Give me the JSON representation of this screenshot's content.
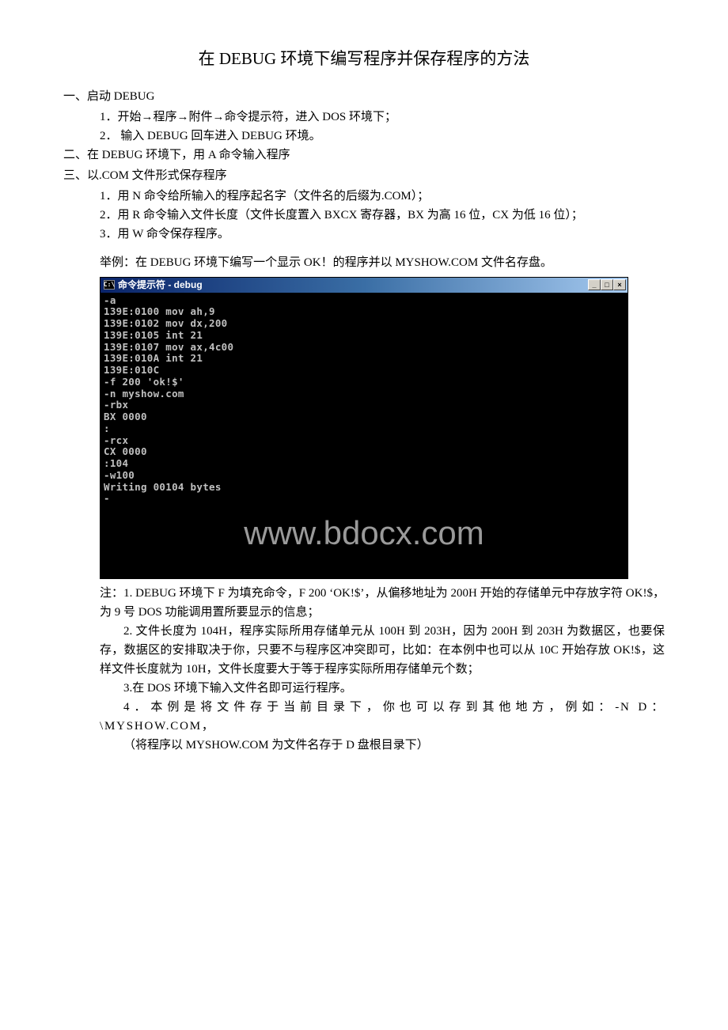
{
  "title": "在 DEBUG 环境下编写程序并保存程序的方法",
  "section1": {
    "heading": "一、启动 DEBUG",
    "item1": "1．开始→程序→附件→命令提示符，进入 DOS 环境下；",
    "item2": "2． 输入 DEBUG 回车进入 DEBUG 环境。"
  },
  "section2": {
    "heading": "二、在 DEBUG 环境下，用 A 命令输入程序"
  },
  "section3": {
    "heading": "三、以.COM 文件形式保存程序",
    "item1": "1．用 N 命令给所输入的程序起名字（文件名的后缀为.COM）；",
    "item2": "2．用 R 命令输入文件长度（文件长度置入 BXCX 寄存器，BX 为高 16 位，CX 为低 16 位）；",
    "item3": "3．用 W 命令保存程序。"
  },
  "example": "举例：在 DEBUG 环境下编写一个显示 OK！的程序并以 MYSHOW.COM 文件名存盘。",
  "terminal": {
    "title_prefix": "C:\\",
    "title": "命令提示符 - debug",
    "minimize": "_",
    "maximize": "□",
    "close": "×",
    "content": "-a\n139E:0100 mov ah,9\n139E:0102 mov dx,200\n139E:0105 int 21\n139E:0107 mov ax,4c00\n139E:010A int 21\n139E:010C\n-f 200 'ok!$'\n-n myshow.com\n-rbx\nBX 0000\n:\n-rcx\nCX 0000\n:104\n-w100\nWriting 00104 bytes\n-"
  },
  "watermark": "www.bdocx.com",
  "notes": {
    "n1": "注：1. DEBUG 环境下 F 为填充命令，F 200 ‘OK!$’，从偏移地址为 200H 开始的存储单元中存放字符 OK!$，为 9 号 DOS 功能调用置所要显示的信息；",
    "n2": "2. 文件长度为 104H，程序实际所用存储单元从 100H 到 203H，因为 200H 到 203H 为数据区，也要保存，数据区的安排取决于你，只要不与程序区冲突即可，比如：在本例中也可以从 10C 开始存放 OK!$，这样文件长度就为 10H，文件长度要大于等于程序实际所用存储单元个数；",
    "n3": "3.在 DOS 环境下输入文件名即可运行程序。",
    "n4": "4．本例是将文件存于当前目录下，你也可以存到其他地方，例如：-N D：\\MYSHOW.COM，",
    "n5": "（将程序以 MYSHOW.COM 为文件名存于 D 盘根目录下）"
  }
}
